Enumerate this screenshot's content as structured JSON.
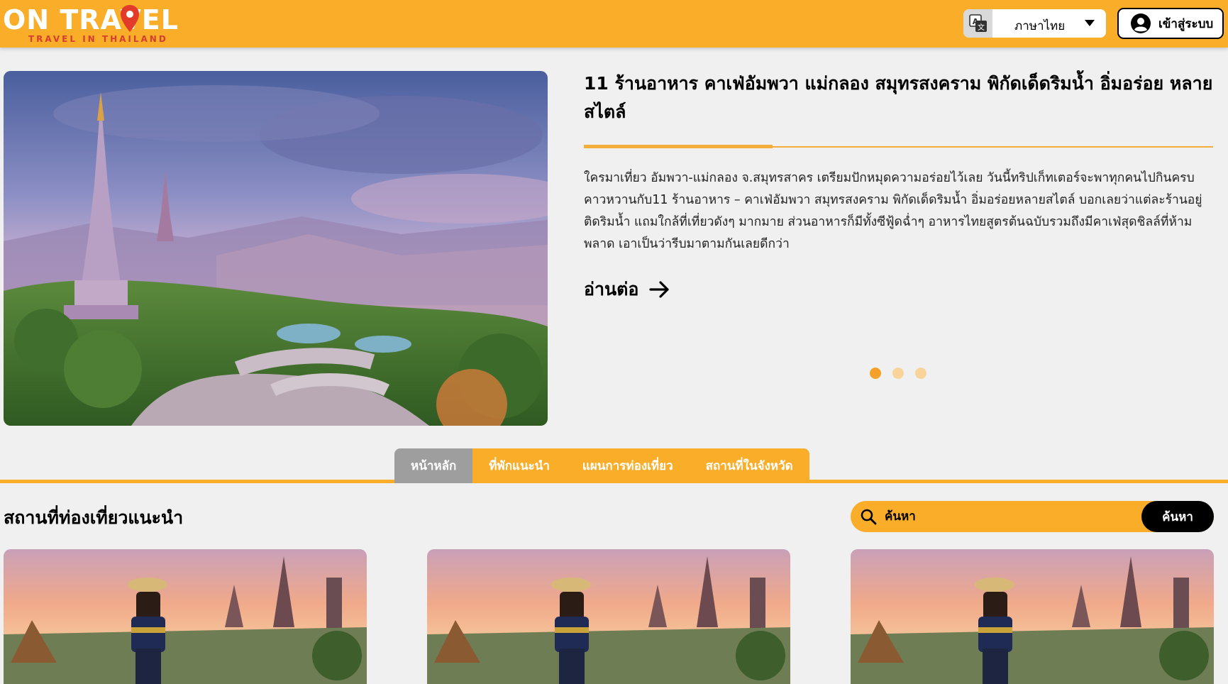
{
  "header": {
    "logo_text": "ON TRAVEL",
    "logo_tagline": "TRAVEL IN THAILAND",
    "language_label": "ภาษาไทย",
    "login_label": "เข้าสู่ระบบ"
  },
  "hero": {
    "title": "11 ร้านอาหาร คาเฟ่อัมพวา แม่กลอง สมุทรสงคราม พิกัดเด็ดริมน้ำ อิ่มอร่อย หลายสไตล์",
    "description": "ใครมาเที่ยว อัมพวา-แม่กลอง จ.สมุทรสาคร เตรียมปักหมุดความอร่อยไว้เลย วันนี้ทริปเก็ทเตอร์จะพาทุกคนไปกินครบคาวหวานกับ11 ร้านอาหาร – คาเฟ่อัมพวา สมุทรสงคราม พิกัดเด็ดริมน้ำ อิ่มอร่อยหลายสไตล์ บอกเลยว่าแต่ละร้านอยู่ติดริมน้ำ แถมใกล้ที่เที่ยวดังๆ มากมาย ส่วนอาหารก็มีทั้งซีฟู้ดฉ่ำๆ อาหารไทยสูตรต้นฉบับรวมถึงมีคาเฟ่สุดชิลล์ที่ห้ามพลาด เอาเป็นว่ารีบมาตามกันเลยดีกว่า",
    "read_more_label": "อ่านต่อ",
    "slides_total": 3,
    "active_slide": 1
  },
  "tabs": [
    {
      "label": "หน้าหลัก",
      "active": true
    },
    {
      "label": "ที่พักแนะนำ",
      "active": false
    },
    {
      "label": "แผนการท่องเที่ยว",
      "active": false
    },
    {
      "label": "สถานที่ในจังหวัด",
      "active": false
    }
  ],
  "section": {
    "title": "สถานที่ท่องเที่ยวแนะนำ"
  },
  "search": {
    "placeholder": "ค้นหา",
    "button_label": "ค้นหา"
  },
  "colors": {
    "brand": "#f9ad28",
    "tab_active": "#9e9e9e",
    "background": "#f0f0f0"
  }
}
